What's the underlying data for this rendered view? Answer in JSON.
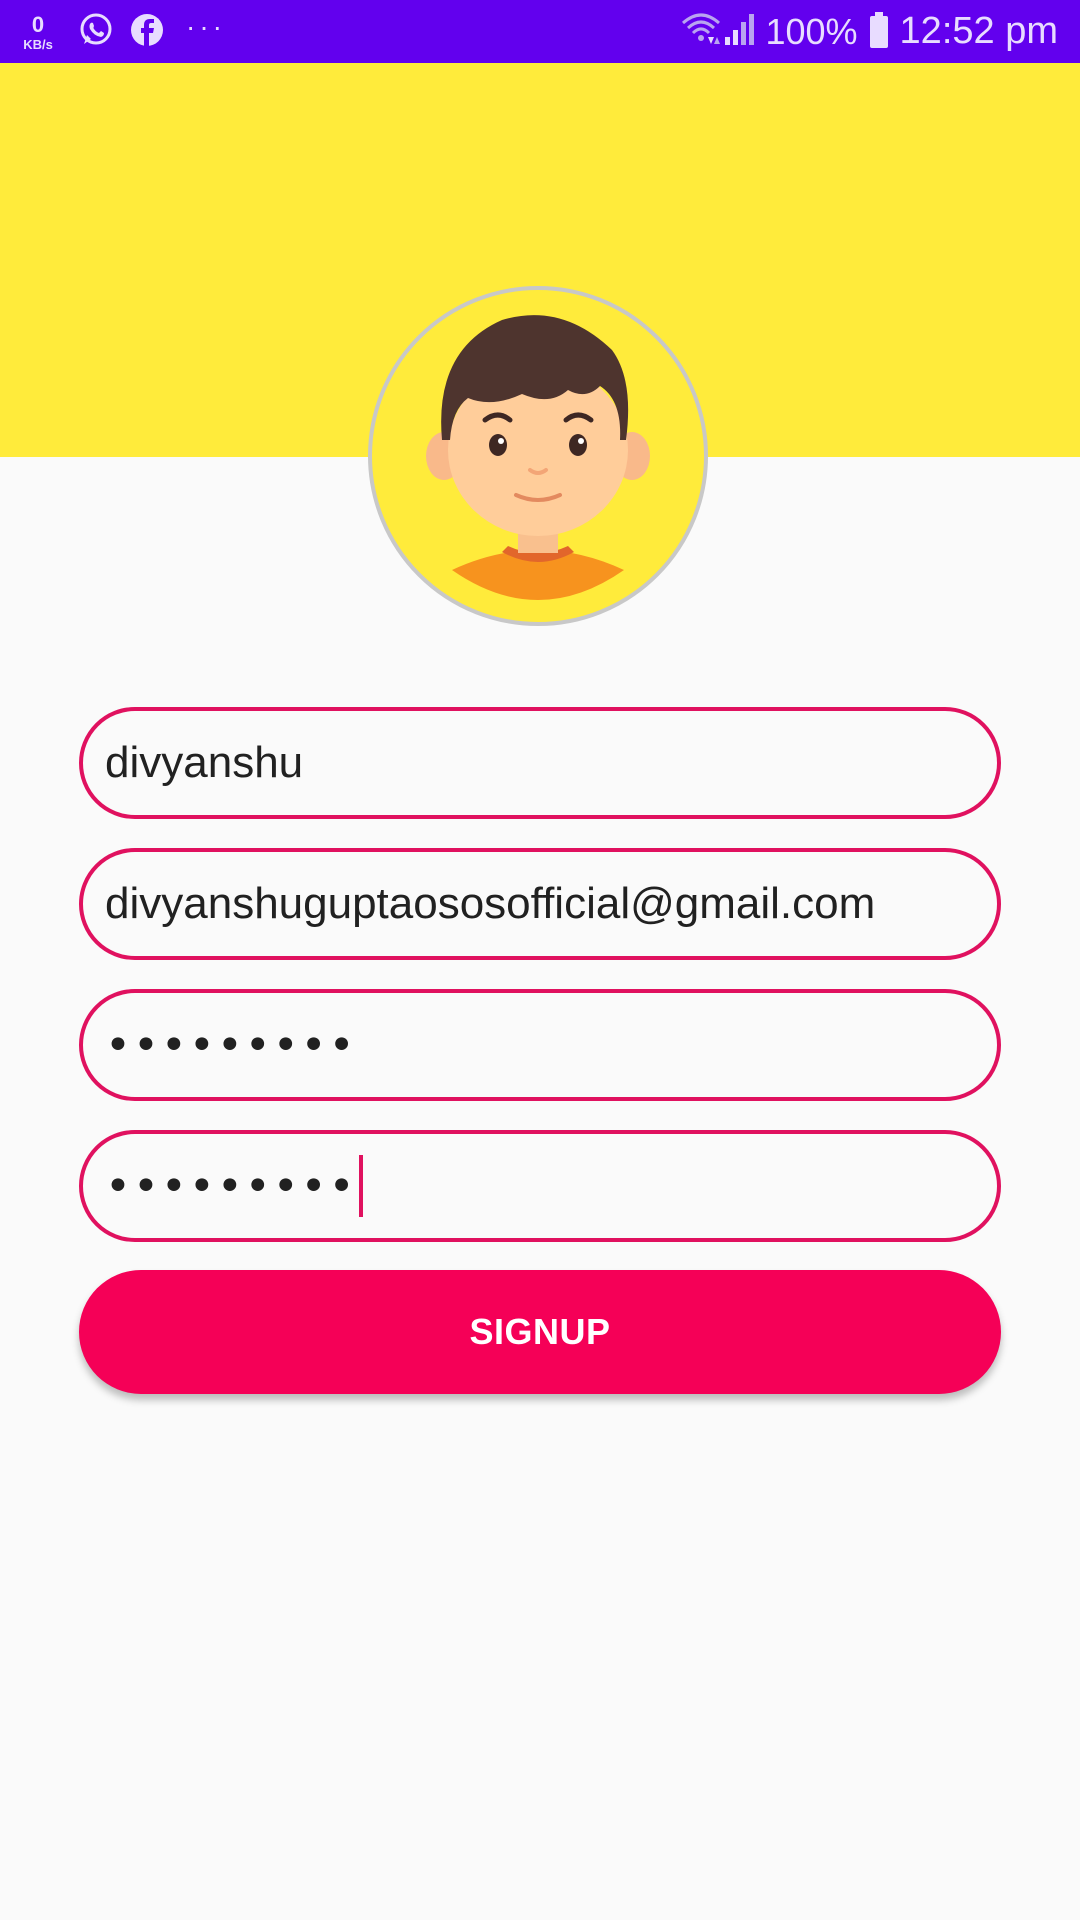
{
  "status_bar": {
    "speed_value": "0",
    "speed_unit": "KB/s",
    "notification_icons": [
      "whatsapp-icon",
      "facebook-icon",
      "more-dots-icon"
    ],
    "right_icons": [
      "wifi-icon",
      "signal-icon",
      "battery-icon"
    ],
    "battery": "100%",
    "time": "12:52 pm",
    "bg_color": "#6200ee"
  },
  "header": {
    "bg_color": "#ffeb3b",
    "avatar": "boy-avatar-icon"
  },
  "form": {
    "username_value": "divyanshu",
    "email_value": "divyanshuguptaososofficial@gmail.com",
    "password_value": "•••••••••",
    "confirm_password_value": "•••••••••",
    "border_color": "#e0115f"
  },
  "signup_button": {
    "label": "SIGNUP",
    "bg_color": "#f50057"
  }
}
